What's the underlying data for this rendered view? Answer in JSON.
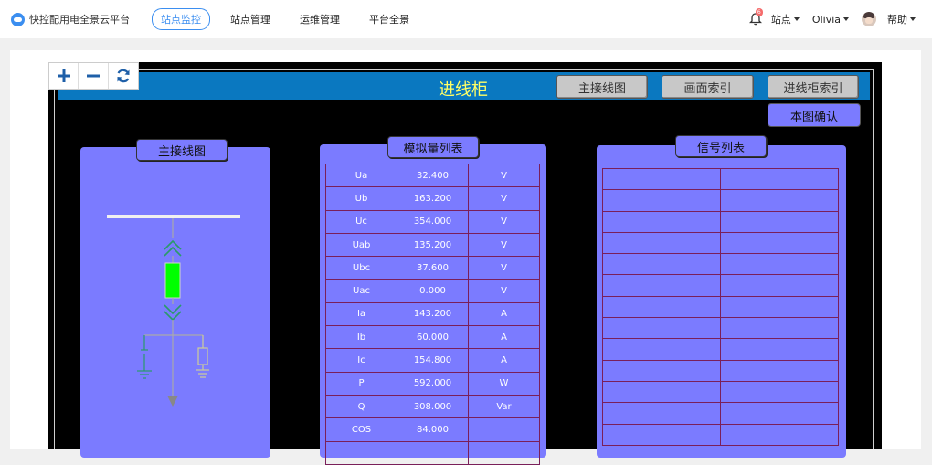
{
  "topbar": {
    "brand_title": "快控配用电全景云平台",
    "nav": [
      {
        "label": "站点监控",
        "active": true
      },
      {
        "label": "站点管理",
        "active": false
      },
      {
        "label": "运维管理",
        "active": false
      },
      {
        "label": "平台全景",
        "active": false
      }
    ],
    "notification_count": "6",
    "site_menu": "站点",
    "user_name": "Olivia",
    "help_menu": "帮助"
  },
  "screen": {
    "title": "进线柜",
    "buttons": [
      "主接线图",
      "画面索引",
      "进线柜索引"
    ],
    "confirm_button": "本图确认"
  },
  "panels": {
    "diagram_title": "主接线图",
    "analog_title": "模拟量列表",
    "signal_title": "信号列表"
  },
  "analog_rows": [
    [
      "Ua",
      "32.400",
      "V"
    ],
    [
      "Ub",
      "163.200",
      "V"
    ],
    [
      "Uc",
      "354.000",
      "V"
    ],
    [
      "Uab",
      "135.200",
      "V"
    ],
    [
      "Ubc",
      "37.600",
      "V"
    ],
    [
      "Uac",
      "0.000",
      "V"
    ],
    [
      "Ia",
      "143.200",
      "A"
    ],
    [
      "Ib",
      "60.000",
      "A"
    ],
    [
      "Ic",
      "154.800",
      "A"
    ],
    [
      "P",
      "592.000",
      "W"
    ],
    [
      "Q",
      "308.000",
      "Var"
    ],
    [
      "COS",
      "84.000",
      ""
    ],
    [
      "",
      "",
      ""
    ]
  ],
  "signal_row_count": 13,
  "colors": {
    "header": "#0a78c0",
    "title_text": "#ffff66",
    "panel": "#7b7bff",
    "grid_line": "#7a1f5a",
    "breaker": "#00ff00",
    "accent": "#3b8ef0"
  }
}
